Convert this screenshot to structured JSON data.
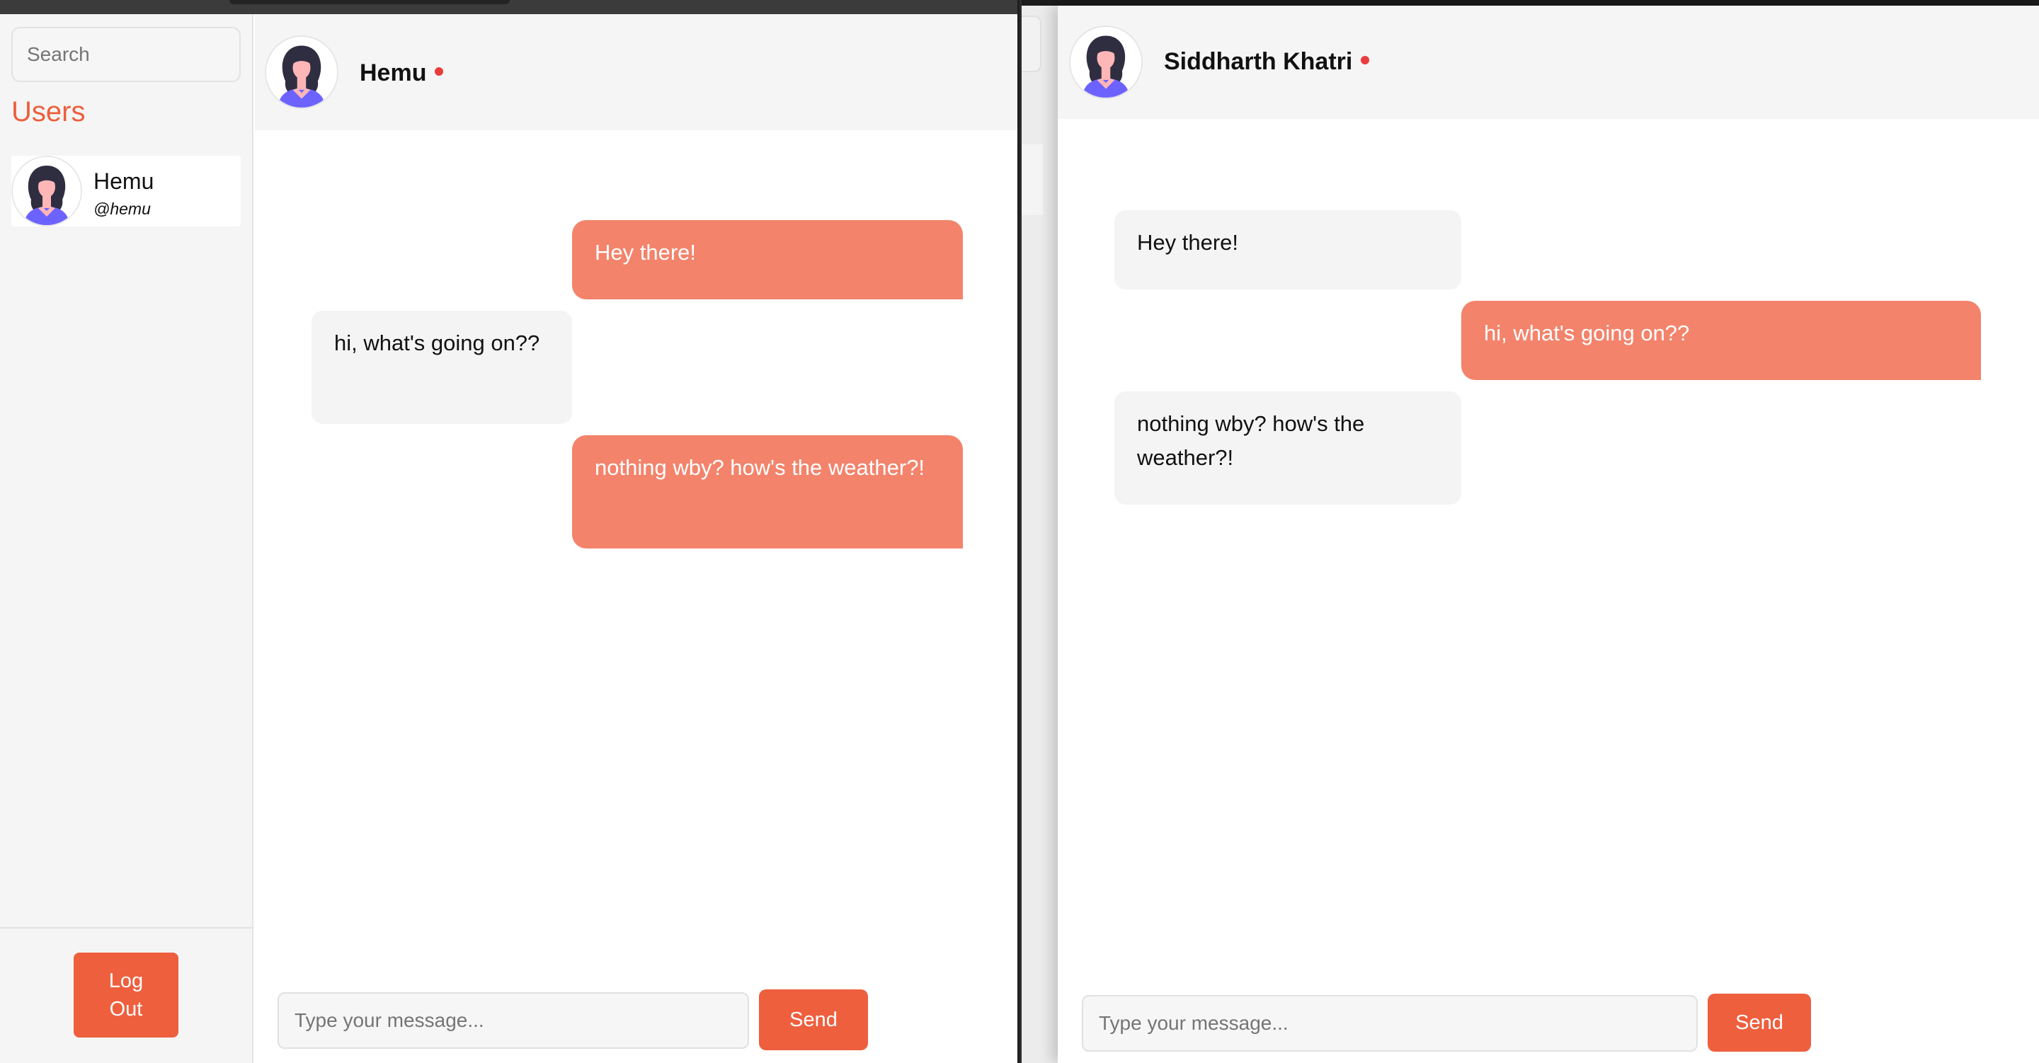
{
  "left_window": {
    "sidebar": {
      "search_placeholder": "Search",
      "users_heading": "Users",
      "users": [
        {
          "name": "Hemu",
          "handle": "@hemu"
        }
      ],
      "logout_label": "Log Out"
    },
    "chat": {
      "contact_name": "Hemu",
      "status_color": "#e93c3c",
      "messages": [
        {
          "direction": "outgoing",
          "text": "Hey there!"
        },
        {
          "direction": "incoming",
          "text": "hi, what's going on??"
        },
        {
          "direction": "outgoing",
          "text": "nothing wby? how's the weather?!"
        }
      ],
      "input_placeholder": "Type your message...",
      "send_label": "Send"
    }
  },
  "right_window": {
    "chat": {
      "contact_name": "Siddharth Khatri",
      "status_color": "#e93c3c",
      "messages": [
        {
          "direction": "incoming",
          "text": "Hey there!"
        },
        {
          "direction": "outgoing",
          "text": "hi, what's going on??"
        },
        {
          "direction": "incoming",
          "text": "nothing wby? how's the weather?!"
        }
      ],
      "input_placeholder": "Type your message...",
      "send_label": "Send"
    }
  },
  "colors": {
    "accent": "#ee5f3e",
    "outgoing_bubble": "#f3836b",
    "incoming_bubble": "#f4f4f4",
    "sidebar_bg": "#f5f5f5"
  },
  "icons": {
    "avatar": "female-avatar-icon",
    "status": "online-status-dot"
  }
}
